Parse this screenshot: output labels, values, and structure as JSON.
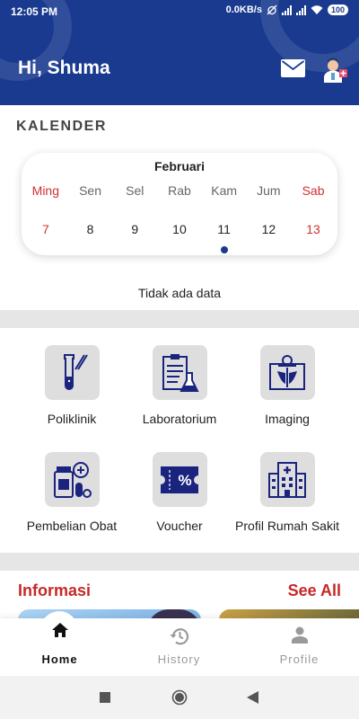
{
  "status_bar": {
    "time": "12:05 PM",
    "speed": "0.0KB/s",
    "battery": "100"
  },
  "header": {
    "greeting": "Hi, Shuma",
    "icons": [
      "mail-icon",
      "avatar-icon"
    ]
  },
  "calendar": {
    "section_title": "KALENDER",
    "month": "Februari",
    "days": [
      {
        "name": "Ming",
        "date": "7",
        "weekend": true
      },
      {
        "name": "Sen",
        "date": "8",
        "weekend": false
      },
      {
        "name": "Sel",
        "date": "9",
        "weekend": false
      },
      {
        "name": "Rab",
        "date": "10",
        "weekend": false
      },
      {
        "name": "Kam",
        "date": "11",
        "weekend": false,
        "selected": true
      },
      {
        "name": "Jum",
        "date": "12",
        "weekend": false
      },
      {
        "name": "Sab",
        "date": "13",
        "weekend": true
      }
    ],
    "empty_text": "Tidak ada data"
  },
  "menu": {
    "items": [
      {
        "label": "Poliklinik",
        "icon": "test-tube-icon"
      },
      {
        "label": "Laboratorium",
        "icon": "lab-clipboard-icon"
      },
      {
        "label": "Imaging",
        "icon": "xray-icon"
      },
      {
        "label": "Pembelian Obat",
        "icon": "medicine-icon"
      },
      {
        "label": "Voucher",
        "icon": "voucher-icon"
      },
      {
        "label": "Profil Rumah Sakit",
        "icon": "hospital-icon"
      }
    ]
  },
  "info": {
    "title": "Informasi",
    "see_all": "See All"
  },
  "bottom_nav": {
    "items": [
      {
        "label": "Home",
        "icon": "home-icon",
        "active": true
      },
      {
        "label": "History",
        "icon": "history-icon",
        "active": false
      },
      {
        "label": "Profile",
        "icon": "profile-icon",
        "active": false
      }
    ]
  },
  "colors": {
    "primary": "#1a3a8f",
    "accent_red": "#c62828",
    "tile_gray": "#dedede"
  }
}
